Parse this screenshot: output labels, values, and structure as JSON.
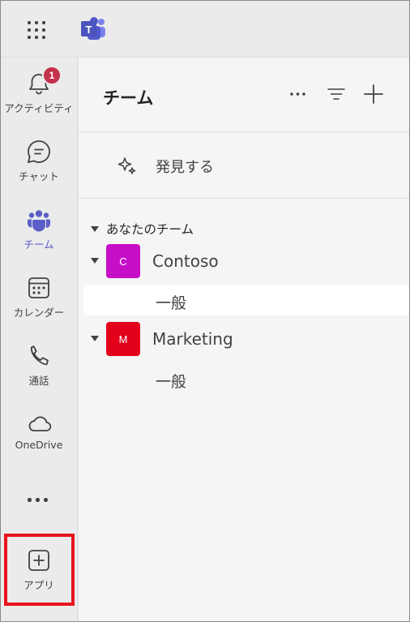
{
  "topbar": {
    "app_launcher_icon": "waffle-grid-icon",
    "logo_icon": "microsoft-teams-logo",
    "logo_letter": "T"
  },
  "rail": {
    "items": [
      {
        "label": "アクティビティ",
        "icon": "bell-icon",
        "badge": "1",
        "active": false
      },
      {
        "label": "チャット",
        "icon": "chat-icon",
        "active": false
      },
      {
        "label": "チーム",
        "icon": "teams-icon",
        "active": true
      },
      {
        "label": "カレンダー",
        "icon": "calendar-icon",
        "active": false
      },
      {
        "label": "通話",
        "icon": "phone-icon",
        "active": false
      },
      {
        "label": "OneDrive",
        "icon": "cloud-icon",
        "active": false
      },
      {
        "label": "アプリ",
        "icon": "add-app-icon",
        "active": false
      }
    ],
    "more_icon": "more-horizontal-icon",
    "highlight_color": "#e8131d"
  },
  "pane": {
    "title": "チーム",
    "header_icons": [
      "more-horizontal-icon",
      "filter-icon",
      "add-icon"
    ],
    "discover_label": "発見する",
    "section_label": "あなたのチーム",
    "teams": [
      {
        "name": "Contoso",
        "initial": "C",
        "color": "#c70ec7",
        "channels": [
          {
            "name": "一般",
            "selected": true
          }
        ]
      },
      {
        "name": "Marketing",
        "initial": "M",
        "color": "#e3001b",
        "channels": [
          {
            "name": "一般",
            "selected": false
          }
        ]
      }
    ]
  },
  "colors": {
    "accent": "#5b5fc7",
    "badge": "#c4314b"
  }
}
